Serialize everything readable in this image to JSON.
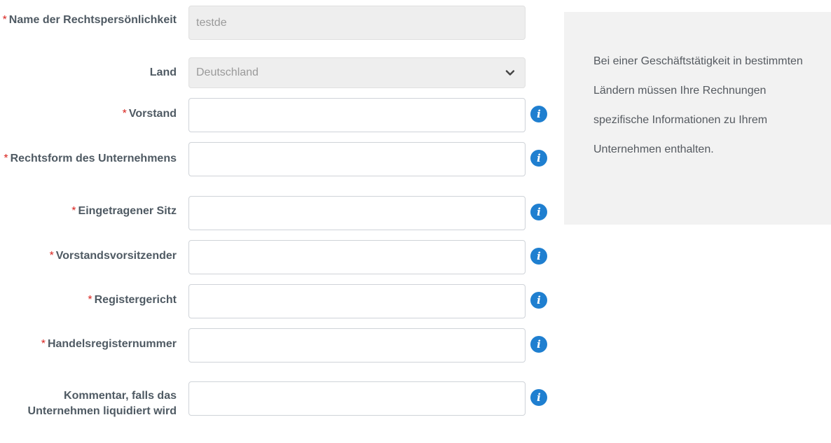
{
  "form": {
    "fields": [
      {
        "label": "Name der Rechtspersönlichkeit",
        "required": "*",
        "value": "testde"
      },
      {
        "label": "Land",
        "value": "Deutschland"
      },
      {
        "label": "Vorstand",
        "required": "*",
        "value": ""
      },
      {
        "label": "Rechtsform des Unternehmens",
        "required": "*",
        "value": ""
      },
      {
        "label": "Eingetragener Sitz",
        "required": "*",
        "value": ""
      },
      {
        "label": "Vorstandsvorsitzender",
        "required": "*",
        "value": ""
      },
      {
        "label": "Registergericht",
        "required": "*",
        "value": ""
      },
      {
        "label": "Handelsregisternummer",
        "required": "*",
        "value": ""
      },
      {
        "label": "Kommentar, falls das Unternehmen liquidiert wird",
        "value": ""
      }
    ],
    "info_icon_glyph": "i"
  },
  "info_box": {
    "text": "Bei einer Geschäftstätigkeit in bestimmten Ländern müssen Ihre Rechnungen spezifische Informationen zu Ihrem Unternehmen enthalten."
  },
  "colors": {
    "required_marker": "#d9241f",
    "label": "#4f5a63",
    "info_icon": "#1f7fd0",
    "info_box_bg": "#f2f2f2",
    "disabled_field_bg": "#eeeeee"
  }
}
